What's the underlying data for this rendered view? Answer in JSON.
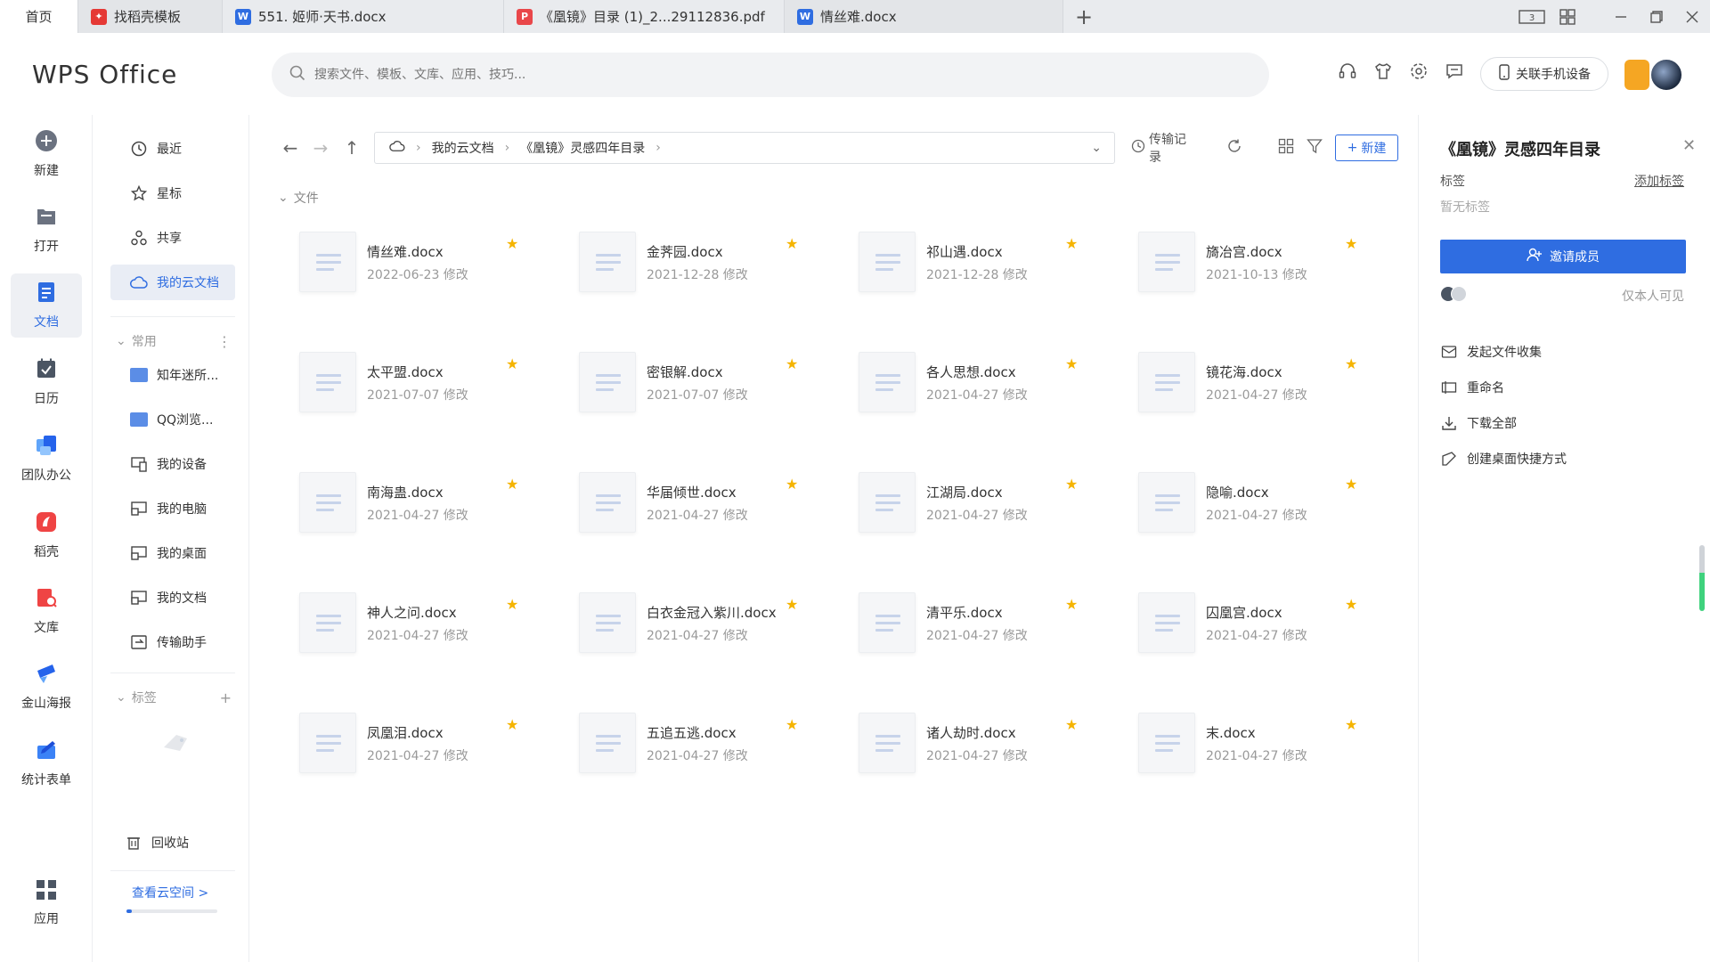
{
  "tabs": {
    "home": "首页",
    "items": [
      {
        "label": "找稻壳模板",
        "icon": "docer-icon"
      },
      {
        "label": "551. 姬师·天书.docx",
        "icon": "word-doc-icon"
      },
      {
        "label": "《凰镜》目录 (1)_2...29112836.pdf",
        "icon": "pdf-icon"
      },
      {
        "label": "情丝难.docx",
        "icon": "word-doc-icon"
      }
    ],
    "new_tab": "+"
  },
  "header": {
    "logo": "WPS Office",
    "search_placeholder": "搜索文件、模板、文库、应用、技巧...",
    "link_phone": "关联手机设备"
  },
  "rail": [
    {
      "label": "新建",
      "icon": "plus-circle-icon",
      "color": "#6b7280"
    },
    {
      "label": "打开",
      "icon": "folder-open-icon",
      "color": "#6b7280"
    },
    {
      "label": "文档",
      "icon": "document-icon",
      "color": "#2f6de1"
    },
    {
      "label": "日历",
      "icon": "calendar-icon",
      "color": "#4b5563"
    },
    {
      "label": "团队办公",
      "icon": "team-icon",
      "color": "#3b82f6"
    },
    {
      "label": "稻壳",
      "icon": "docer-icon",
      "color": "#ef4444"
    },
    {
      "label": "文库",
      "icon": "library-icon",
      "color": "#ef4444"
    },
    {
      "label": "金山海报",
      "icon": "poster-icon",
      "color": "#2563eb"
    },
    {
      "label": "统计表单",
      "icon": "form-icon",
      "color": "#3b82f6"
    },
    {
      "label": "应用",
      "icon": "apps-grid-icon",
      "color": "#4b5563"
    }
  ],
  "nav": {
    "items": [
      {
        "label": "最近",
        "icon": "clock-icon"
      },
      {
        "label": "星标",
        "icon": "star-outline-icon"
      },
      {
        "label": "共享",
        "icon": "share-icon"
      },
      {
        "label": "我的云文档",
        "icon": "cloud-icon"
      }
    ],
    "common_section": "常用",
    "common_items": [
      {
        "label": "知年迷所...",
        "icon": "folder-icon"
      },
      {
        "label": "QQ浏览...",
        "icon": "folder-icon"
      },
      {
        "label": "我的设备",
        "icon": "device-icon"
      },
      {
        "label": "我的电脑",
        "icon": "computer-icon"
      },
      {
        "label": "我的桌面",
        "icon": "desktop-icon"
      },
      {
        "label": "我的文档",
        "icon": "my-docs-icon"
      },
      {
        "label": "传输助手",
        "icon": "transfer-icon"
      }
    ],
    "tags_section": "标签",
    "recycle": "回收站",
    "cloud_space_link": "查看云空间 >"
  },
  "toolbar": {
    "path": [
      "我的云文档",
      "《凰镜》灵感四年目录"
    ],
    "transfer_log": "传输记录",
    "new_button": "新建"
  },
  "files_section": "文件",
  "files": [
    {
      "name": "情丝难.docx",
      "date": "2022-06-23 修改"
    },
    {
      "name": "金荠园.docx",
      "date": "2021-12-28 修改"
    },
    {
      "name": "祁山遇.docx",
      "date": "2021-12-28 修改"
    },
    {
      "name": "旖冶宫.docx",
      "date": "2021-10-13 修改"
    },
    {
      "name": "太平盟.docx",
      "date": "2021-07-07 修改"
    },
    {
      "name": "密银解.docx",
      "date": "2021-07-07 修改"
    },
    {
      "name": "各人思想.docx",
      "date": "2021-04-27 修改"
    },
    {
      "name": "镜花海.docx",
      "date": "2021-04-27 修改"
    },
    {
      "name": "南海蛊.docx",
      "date": "2021-04-27 修改"
    },
    {
      "name": "华届倾世.docx",
      "date": "2021-04-27 修改"
    },
    {
      "name": "江湖局.docx",
      "date": "2021-04-27 修改"
    },
    {
      "name": "隐喻.docx",
      "date": "2021-04-27 修改"
    },
    {
      "name": "神人之问.docx",
      "date": "2021-04-27 修改"
    },
    {
      "name": "白衣金冠入紫川.docx",
      "date": "2021-04-27 修改"
    },
    {
      "name": "清平乐.docx",
      "date": "2021-04-27 修改"
    },
    {
      "name": "囚凰宫.docx",
      "date": "2021-04-27 修改"
    },
    {
      "name": "凤凰泪.docx",
      "date": "2021-04-27 修改"
    },
    {
      "name": "五追五逃.docx",
      "date": "2021-04-27 修改"
    },
    {
      "name": "诸人劫时.docx",
      "date": "2021-04-27 修改"
    },
    {
      "name": "末.docx",
      "date": "2021-04-27 修改"
    }
  ],
  "panel": {
    "title": "《凰镜》灵感四年目录",
    "tag_label": "标签",
    "add_tag": "添加标签",
    "no_tag": "暂无标签",
    "invite": "邀请成员",
    "visibility": "仅本人可见",
    "actions": [
      {
        "label": "发起文件收集",
        "icon": "collect-icon"
      },
      {
        "label": "重命名",
        "icon": "rename-icon"
      },
      {
        "label": "下载全部",
        "icon": "download-icon"
      },
      {
        "label": "创建桌面快捷方式",
        "icon": "shortcut-icon"
      }
    ]
  },
  "colors": {
    "accent": "#2f6de1",
    "star": "#f5b400"
  }
}
